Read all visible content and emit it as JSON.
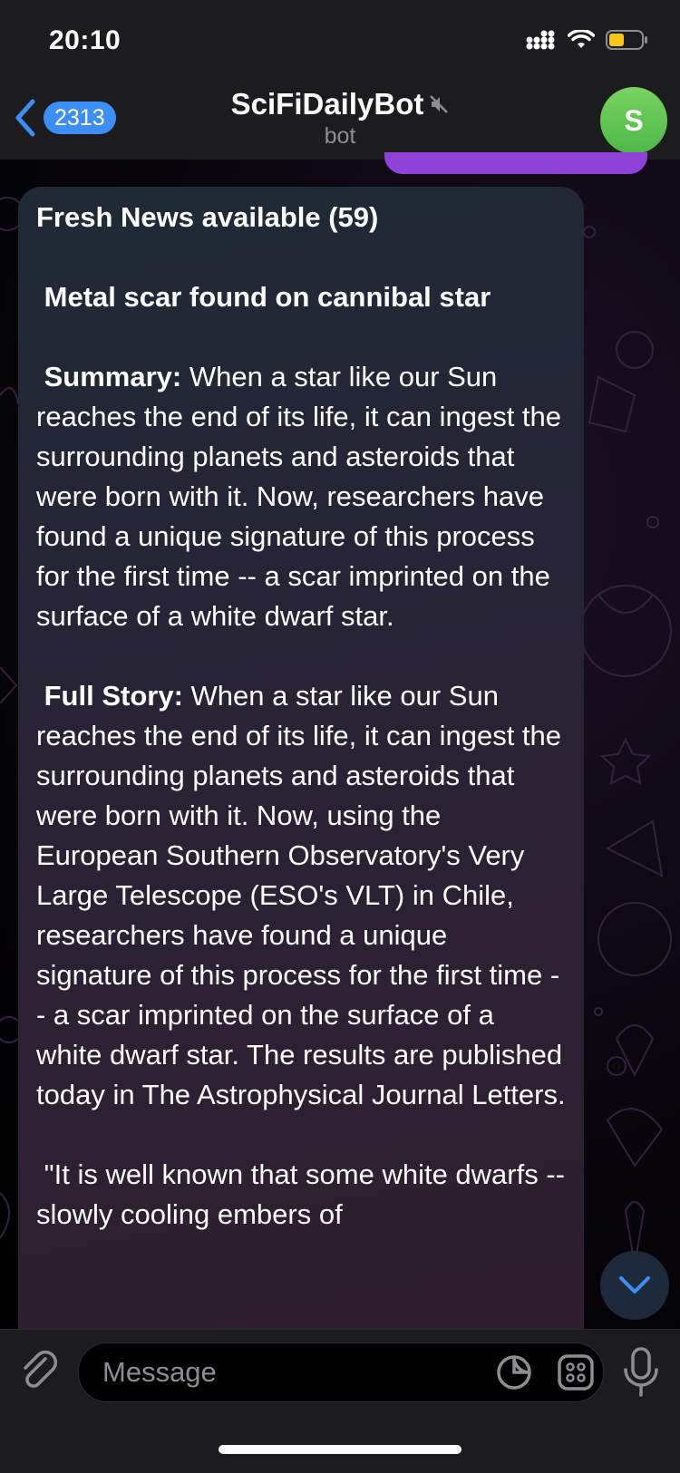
{
  "status_bar": {
    "time": "20:10",
    "battery_color": "#f5c518"
  },
  "header": {
    "back_badge": "2313",
    "title": "SciFiDailyBot",
    "subtitle": "bot",
    "avatar_letter": "S",
    "muted_icon": "speaker-muted-icon"
  },
  "message": {
    "heading": "Fresh News available (59)",
    "article_title": " Metal scar found on cannibal star",
    "summary_label": " Summary:",
    "summary_text": " When a star like our Sun reaches the end of its life, it can ingest the surrounding planets and asteroids that were born with it. Now, researchers have found a unique signature of this process for the first time -- a scar imprinted on the surface of a white dwarf star.",
    "full_label": " Full Story:",
    "full_text": " When a star like our Sun reaches the end of its life, it can ingest the surrounding planets and asteroids that were born with it. Now, using the European Southern Observatory's Very Large Telescope (ESO's VLT) in Chile, researchers have found a unique signature of this process for the first time -- a scar imprinted on the surface of a white dwarf star. The results are published today in The Astrophysical Journal Letters.",
    "quote_start": " \"It is well known that some white dwarfs -- slowly cooling embers of"
  },
  "input": {
    "placeholder": "Message"
  },
  "colors": {
    "accent": "#3e8ef7",
    "avatar": "#5dc253",
    "outgoing_bubble": "#8f43d6"
  }
}
